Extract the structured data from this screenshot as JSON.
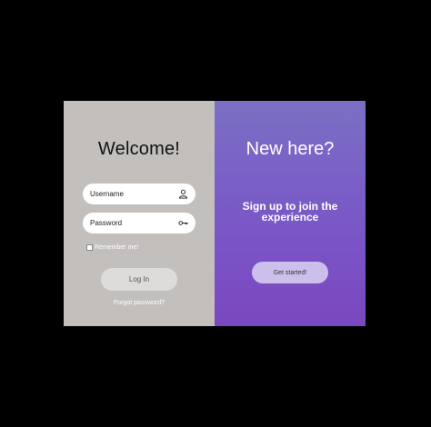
{
  "login": {
    "title": "Welcome!",
    "username_placeholder": "Username",
    "password_placeholder": "Password",
    "username_icon": "user-icon",
    "password_icon": "key-icon",
    "remember_label": "Remember me!",
    "remember_checked": false,
    "login_label": "Log In",
    "forgot_label": "Forgot password?"
  },
  "signup": {
    "title": "New here?",
    "tagline": "Sign up to join the experience",
    "cta_label": "Get started!"
  },
  "colors": {
    "page_background": "#000000",
    "left_panel": "#c3bfbd",
    "right_panel_top": "#7b6fc4",
    "right_panel_bottom": "#7a47c0",
    "login_button": "#dedcdb",
    "cta_button": "#cdbfec"
  }
}
